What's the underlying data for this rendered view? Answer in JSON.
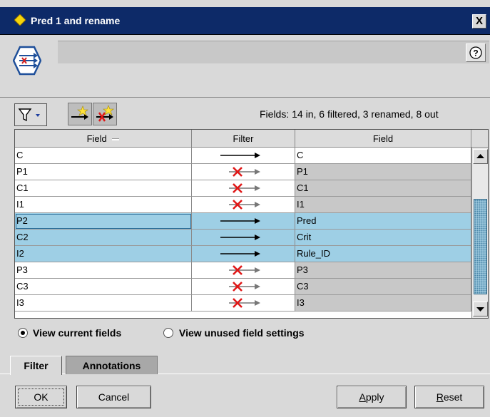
{
  "window": {
    "title": "Pred 1 and rename",
    "close_label": "X"
  },
  "header": {
    "description": "",
    "help_label": "?"
  },
  "toolbar": {
    "status": "Fields: 14 in, 6 filtered, 3 renamed, 8 out"
  },
  "table": {
    "headers": [
      "Field",
      "Filter",
      "Field"
    ],
    "rows": [
      {
        "field": "C",
        "filter": "pass",
        "out": "C",
        "selected": false,
        "out_disabled": false
      },
      {
        "field": "P1",
        "filter": "remove",
        "out": "P1",
        "selected": false,
        "out_disabled": true
      },
      {
        "field": "C1",
        "filter": "remove",
        "out": "C1",
        "selected": false,
        "out_disabled": true
      },
      {
        "field": "I1",
        "filter": "remove",
        "out": "I1",
        "selected": false,
        "out_disabled": true
      },
      {
        "field": "P2",
        "filter": "pass",
        "out": "Pred",
        "selected": true,
        "out_disabled": false
      },
      {
        "field": "C2",
        "filter": "pass",
        "out": "Crit",
        "selected": true,
        "out_disabled": false
      },
      {
        "field": "I2",
        "filter": "pass",
        "out": "Rule_ID",
        "selected": true,
        "out_disabled": false
      },
      {
        "field": "P3",
        "filter": "remove",
        "out": "P3",
        "selected": false,
        "out_disabled": true
      },
      {
        "field": "C3",
        "filter": "remove",
        "out": "C3",
        "selected": false,
        "out_disabled": true
      },
      {
        "field": "I3",
        "filter": "remove",
        "out": "I3",
        "selected": false,
        "out_disabled": true
      }
    ]
  },
  "view_options": [
    {
      "label": "View current fields",
      "selected": true
    },
    {
      "label": "View unused field settings",
      "selected": false
    }
  ],
  "tabs": [
    {
      "label": "Filter",
      "active": true
    },
    {
      "label": "Annotations",
      "active": false
    }
  ],
  "buttons": {
    "ok": "OK",
    "cancel": "Cancel",
    "apply": "Apply",
    "reset": "Reset"
  },
  "colors": {
    "title_bar": "#0d2a68",
    "selection": "#9ecfe5",
    "remove_mark": "#e01818"
  },
  "icons": {
    "title": "diamond-node-icon",
    "node": "filter-node-icon",
    "help": "help-icon",
    "filter_menu": "funnel-icon",
    "include_all": "include-all-fields-icon",
    "exclude_all": "exclude-all-fields-icon"
  }
}
